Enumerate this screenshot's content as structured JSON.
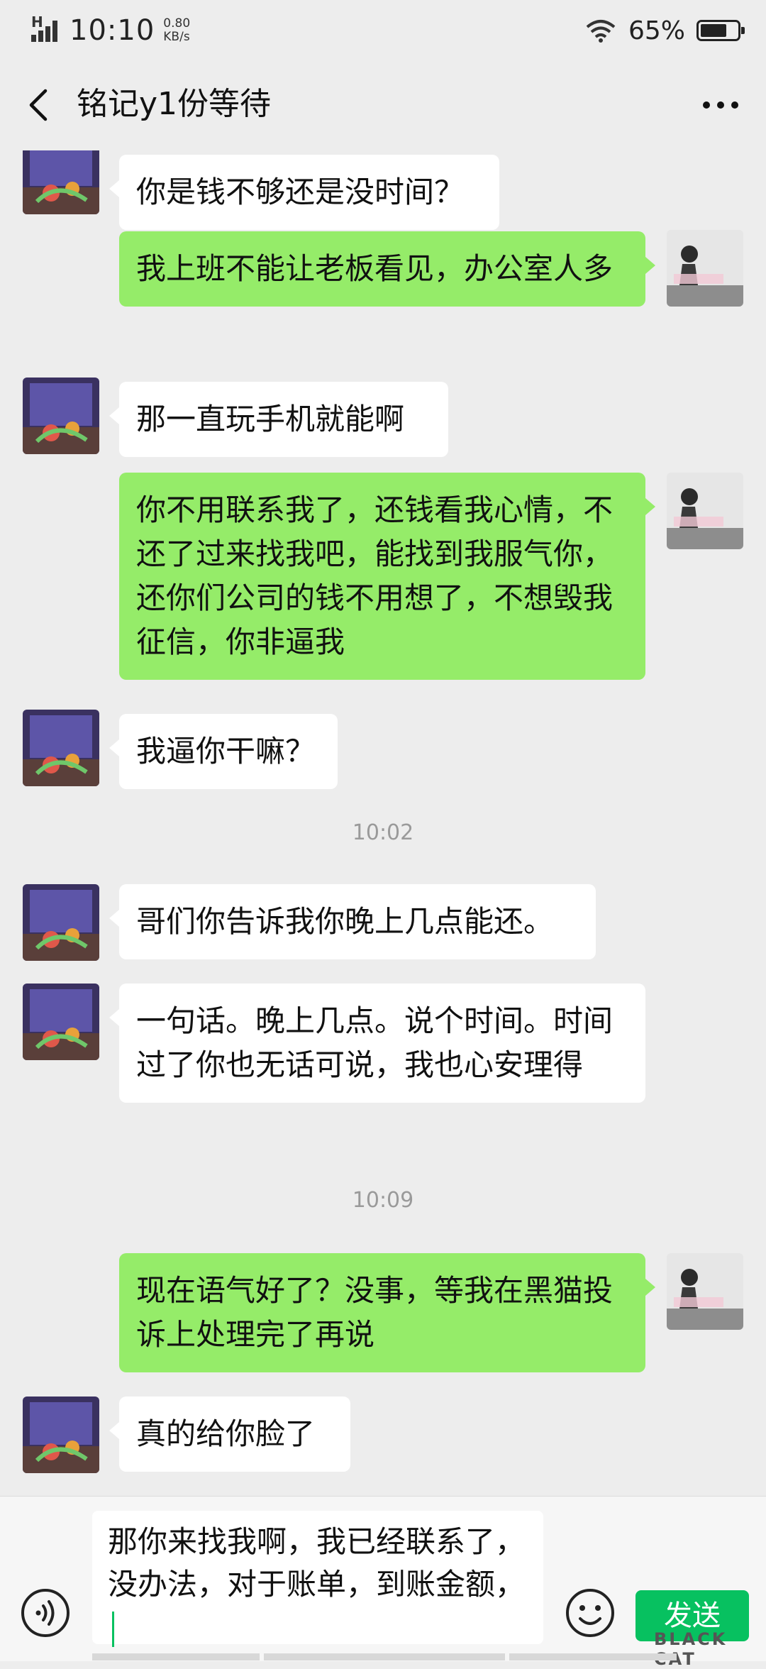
{
  "status_bar": {
    "network": "H",
    "time": "10:10",
    "speed_value": "0.80",
    "speed_unit": "KB/s",
    "battery": "65%"
  },
  "header": {
    "title": "铭记y1份等待"
  },
  "messages": [
    {
      "side": "in",
      "text": "你是钱不够还是没时间？"
    },
    {
      "side": "out",
      "text": "我上班不能让老板看见，办公室人多"
    },
    {
      "side": "in",
      "text": "那一直玩手机就能啊"
    },
    {
      "side": "out",
      "text": "你不用联系我了，还钱看我心情，不还了过来找我吧，能找到我服气你，还你们公司的钱不用想了，不想毁我征信，你非逼我"
    },
    {
      "side": "in",
      "text": "我逼你干嘛？"
    },
    {
      "type": "time",
      "text": "10:02"
    },
    {
      "side": "in",
      "text": "哥们你告诉我你晚上几点能还。"
    },
    {
      "side": "in",
      "text": "一句话。晚上几点。说个时间。时间过了你也无话可说，我也心安理得"
    },
    {
      "type": "time",
      "text": "10:09"
    },
    {
      "side": "out",
      "text": "现在语气好了？没事，等我在黑猫投诉上处理完了再说"
    },
    {
      "side": "in",
      "text": "真的给你脸了"
    }
  ],
  "input": {
    "text": "那你来找我啊，我已经联系了，没办法，对于账单，到账金额，"
  },
  "send_label": "发送",
  "watermark": "BLACK CAT",
  "colors": {
    "out_bubble": "#95ec69",
    "in_bubble": "#ffffff",
    "background": "#ededed",
    "send_button": "#07c160"
  }
}
